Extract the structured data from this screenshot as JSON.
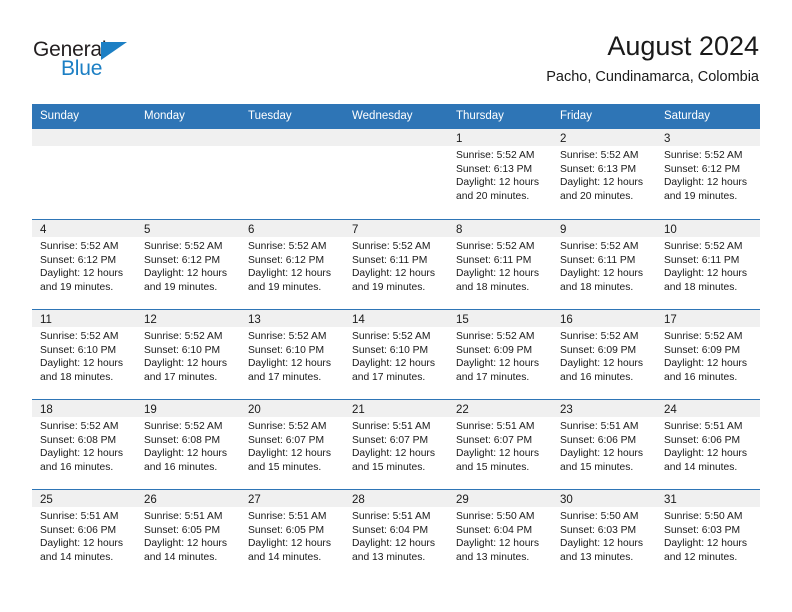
{
  "brand": {
    "name_top": "General",
    "name_bottom": "Blue",
    "triangle_color": "#1c7fc4"
  },
  "header": {
    "title": "August 2024",
    "subtitle": "Pacho, Cundinamarca, Colombia"
  },
  "theme": {
    "header_blue": "#2e75b6",
    "day_band_gray": "#f0f0f0",
    "text": "#1a1a1a"
  },
  "weekdays": [
    "Sunday",
    "Monday",
    "Tuesday",
    "Wednesday",
    "Thursday",
    "Friday",
    "Saturday"
  ],
  "weeks": [
    [
      {
        "day": "",
        "sunrise": "",
        "sunset": "",
        "daylight1": "",
        "daylight2": ""
      },
      {
        "day": "",
        "sunrise": "",
        "sunset": "",
        "daylight1": "",
        "daylight2": ""
      },
      {
        "day": "",
        "sunrise": "",
        "sunset": "",
        "daylight1": "",
        "daylight2": ""
      },
      {
        "day": "",
        "sunrise": "",
        "sunset": "",
        "daylight1": "",
        "daylight2": ""
      },
      {
        "day": "1",
        "sunrise": "Sunrise: 5:52 AM",
        "sunset": "Sunset: 6:13 PM",
        "daylight1": "Daylight: 12 hours",
        "daylight2": "and 20 minutes."
      },
      {
        "day": "2",
        "sunrise": "Sunrise: 5:52 AM",
        "sunset": "Sunset: 6:13 PM",
        "daylight1": "Daylight: 12 hours",
        "daylight2": "and 20 minutes."
      },
      {
        "day": "3",
        "sunrise": "Sunrise: 5:52 AM",
        "sunset": "Sunset: 6:12 PM",
        "daylight1": "Daylight: 12 hours",
        "daylight2": "and 19 minutes."
      }
    ],
    [
      {
        "day": "4",
        "sunrise": "Sunrise: 5:52 AM",
        "sunset": "Sunset: 6:12 PM",
        "daylight1": "Daylight: 12 hours",
        "daylight2": "and 19 minutes."
      },
      {
        "day": "5",
        "sunrise": "Sunrise: 5:52 AM",
        "sunset": "Sunset: 6:12 PM",
        "daylight1": "Daylight: 12 hours",
        "daylight2": "and 19 minutes."
      },
      {
        "day": "6",
        "sunrise": "Sunrise: 5:52 AM",
        "sunset": "Sunset: 6:12 PM",
        "daylight1": "Daylight: 12 hours",
        "daylight2": "and 19 minutes."
      },
      {
        "day": "7",
        "sunrise": "Sunrise: 5:52 AM",
        "sunset": "Sunset: 6:11 PM",
        "daylight1": "Daylight: 12 hours",
        "daylight2": "and 19 minutes."
      },
      {
        "day": "8",
        "sunrise": "Sunrise: 5:52 AM",
        "sunset": "Sunset: 6:11 PM",
        "daylight1": "Daylight: 12 hours",
        "daylight2": "and 18 minutes."
      },
      {
        "day": "9",
        "sunrise": "Sunrise: 5:52 AM",
        "sunset": "Sunset: 6:11 PM",
        "daylight1": "Daylight: 12 hours",
        "daylight2": "and 18 minutes."
      },
      {
        "day": "10",
        "sunrise": "Sunrise: 5:52 AM",
        "sunset": "Sunset: 6:11 PM",
        "daylight1": "Daylight: 12 hours",
        "daylight2": "and 18 minutes."
      }
    ],
    [
      {
        "day": "11",
        "sunrise": "Sunrise: 5:52 AM",
        "sunset": "Sunset: 6:10 PM",
        "daylight1": "Daylight: 12 hours",
        "daylight2": "and 18 minutes."
      },
      {
        "day": "12",
        "sunrise": "Sunrise: 5:52 AM",
        "sunset": "Sunset: 6:10 PM",
        "daylight1": "Daylight: 12 hours",
        "daylight2": "and 17 minutes."
      },
      {
        "day": "13",
        "sunrise": "Sunrise: 5:52 AM",
        "sunset": "Sunset: 6:10 PM",
        "daylight1": "Daylight: 12 hours",
        "daylight2": "and 17 minutes."
      },
      {
        "day": "14",
        "sunrise": "Sunrise: 5:52 AM",
        "sunset": "Sunset: 6:10 PM",
        "daylight1": "Daylight: 12 hours",
        "daylight2": "and 17 minutes."
      },
      {
        "day": "15",
        "sunrise": "Sunrise: 5:52 AM",
        "sunset": "Sunset: 6:09 PM",
        "daylight1": "Daylight: 12 hours",
        "daylight2": "and 17 minutes."
      },
      {
        "day": "16",
        "sunrise": "Sunrise: 5:52 AM",
        "sunset": "Sunset: 6:09 PM",
        "daylight1": "Daylight: 12 hours",
        "daylight2": "and 16 minutes."
      },
      {
        "day": "17",
        "sunrise": "Sunrise: 5:52 AM",
        "sunset": "Sunset: 6:09 PM",
        "daylight1": "Daylight: 12 hours",
        "daylight2": "and 16 minutes."
      }
    ],
    [
      {
        "day": "18",
        "sunrise": "Sunrise: 5:52 AM",
        "sunset": "Sunset: 6:08 PM",
        "daylight1": "Daylight: 12 hours",
        "daylight2": "and 16 minutes."
      },
      {
        "day": "19",
        "sunrise": "Sunrise: 5:52 AM",
        "sunset": "Sunset: 6:08 PM",
        "daylight1": "Daylight: 12 hours",
        "daylight2": "and 16 minutes."
      },
      {
        "day": "20",
        "sunrise": "Sunrise: 5:52 AM",
        "sunset": "Sunset: 6:07 PM",
        "daylight1": "Daylight: 12 hours",
        "daylight2": "and 15 minutes."
      },
      {
        "day": "21",
        "sunrise": "Sunrise: 5:51 AM",
        "sunset": "Sunset: 6:07 PM",
        "daylight1": "Daylight: 12 hours",
        "daylight2": "and 15 minutes."
      },
      {
        "day": "22",
        "sunrise": "Sunrise: 5:51 AM",
        "sunset": "Sunset: 6:07 PM",
        "daylight1": "Daylight: 12 hours",
        "daylight2": "and 15 minutes."
      },
      {
        "day": "23",
        "sunrise": "Sunrise: 5:51 AM",
        "sunset": "Sunset: 6:06 PM",
        "daylight1": "Daylight: 12 hours",
        "daylight2": "and 15 minutes."
      },
      {
        "day": "24",
        "sunrise": "Sunrise: 5:51 AM",
        "sunset": "Sunset: 6:06 PM",
        "daylight1": "Daylight: 12 hours",
        "daylight2": "and 14 minutes."
      }
    ],
    [
      {
        "day": "25",
        "sunrise": "Sunrise: 5:51 AM",
        "sunset": "Sunset: 6:06 PM",
        "daylight1": "Daylight: 12 hours",
        "daylight2": "and 14 minutes."
      },
      {
        "day": "26",
        "sunrise": "Sunrise: 5:51 AM",
        "sunset": "Sunset: 6:05 PM",
        "daylight1": "Daylight: 12 hours",
        "daylight2": "and 14 minutes."
      },
      {
        "day": "27",
        "sunrise": "Sunrise: 5:51 AM",
        "sunset": "Sunset: 6:05 PM",
        "daylight1": "Daylight: 12 hours",
        "daylight2": "and 14 minutes."
      },
      {
        "day": "28",
        "sunrise": "Sunrise: 5:51 AM",
        "sunset": "Sunset: 6:04 PM",
        "daylight1": "Daylight: 12 hours",
        "daylight2": "and 13 minutes."
      },
      {
        "day": "29",
        "sunrise": "Sunrise: 5:50 AM",
        "sunset": "Sunset: 6:04 PM",
        "daylight1": "Daylight: 12 hours",
        "daylight2": "and 13 minutes."
      },
      {
        "day": "30",
        "sunrise": "Sunrise: 5:50 AM",
        "sunset": "Sunset: 6:03 PM",
        "daylight1": "Daylight: 12 hours",
        "daylight2": "and 13 minutes."
      },
      {
        "day": "31",
        "sunrise": "Sunrise: 5:50 AM",
        "sunset": "Sunset: 6:03 PM",
        "daylight1": "Daylight: 12 hours",
        "daylight2": "and 12 minutes."
      }
    ]
  ]
}
